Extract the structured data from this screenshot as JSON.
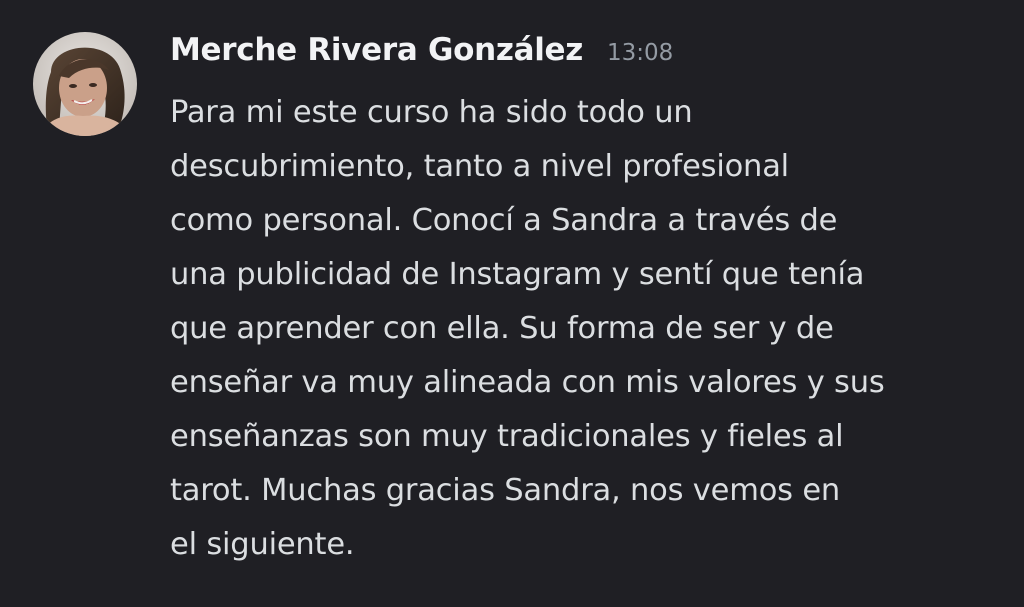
{
  "message": {
    "author": "Merche Rivera González",
    "timestamp": "13:08",
    "avatar_icon": "user-avatar-photo",
    "lines": [
      "Para mi este curso ha sido todo un",
      "descubrimiento, tanto a nivel profesional",
      "como personal. Conocí a Sandra a través de",
      "una publicidad de Instagram y sentí que tenía",
      "que aprender con ella. Su forma de ser y de",
      "enseñar va muy alineada con mis valores y sus",
      "enseñanzas son muy tradicionales y fieles al",
      "tarot. Muchas gracias Sandra, nos vemos en",
      "el siguiente."
    ]
  },
  "colors": {
    "background": "#1f1f24",
    "username": "#f2f3f5",
    "timestamp": "#949ba4",
    "text": "#dbdee1"
  }
}
